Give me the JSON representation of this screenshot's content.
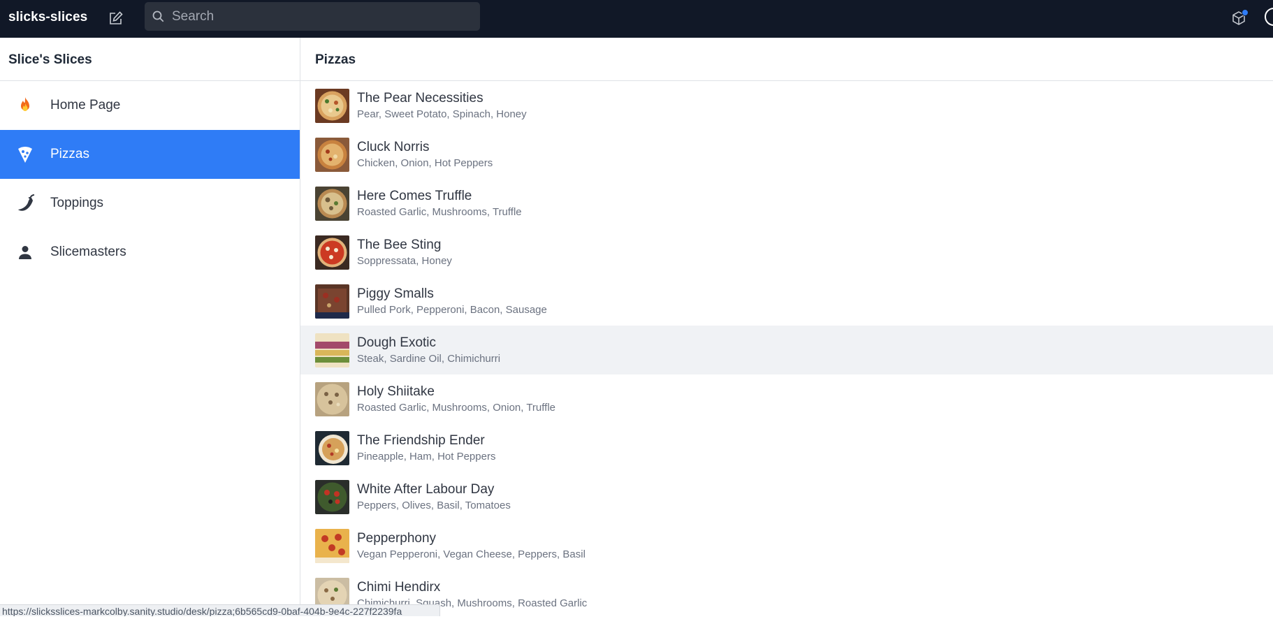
{
  "app": {
    "title": "slicks-slices"
  },
  "search": {
    "placeholder": "Search",
    "value": ""
  },
  "sidebar": {
    "title": "Slice's Slices",
    "items": [
      {
        "label": "Home Page",
        "icon": "fire-icon",
        "active": false
      },
      {
        "label": "Pizzas",
        "icon": "pizza-icon",
        "active": true
      },
      {
        "label": "Toppings",
        "icon": "pepper-icon",
        "active": false
      },
      {
        "label": "Slicemasters",
        "icon": "person-icon",
        "active": false
      }
    ]
  },
  "main": {
    "title": "Pizzas",
    "pizzas": [
      {
        "name": "The Pear Necessities",
        "toppings": "Pear, Sweet Potato, Spinach, Honey"
      },
      {
        "name": "Cluck Norris",
        "toppings": "Chicken, Onion, Hot Peppers"
      },
      {
        "name": "Here Comes Truffle",
        "toppings": "Roasted Garlic, Mushrooms, Truffle"
      },
      {
        "name": "The Bee Sting",
        "toppings": "Soppressata, Honey"
      },
      {
        "name": "Piggy Smalls",
        "toppings": "Pulled Pork, Pepperoni, Bacon, Sausage"
      },
      {
        "name": "Dough Exotic",
        "toppings": "Steak, Sardine Oil, Chimichurri"
      },
      {
        "name": "Holy Shiitake",
        "toppings": "Roasted Garlic, Mushrooms, Onion, Truffle"
      },
      {
        "name": "The Friendship Ender",
        "toppings": "Pineapple, Ham, Hot Peppers"
      },
      {
        "name": "White After Labour Day",
        "toppings": "Peppers, Olives, Basil, Tomatoes"
      },
      {
        "name": "Pepperphony",
        "toppings": "Vegan Pepperoni, Vegan Cheese, Peppers, Basil"
      },
      {
        "name": "Chimi Hendirx",
        "toppings": "Chimichurri, Squash, Mushrooms, Roasted Garlic"
      }
    ]
  },
  "status_url": "https://slicksslices-markcolby.sanity.studio/desk/pizza;6b565cd9-0baf-404b-9e4c-227f2239fa",
  "colors": {
    "navbar": "#111827",
    "accent": "#2f7cf6",
    "hover_row": "#f0f2f5",
    "border": "#dfe2e6"
  }
}
